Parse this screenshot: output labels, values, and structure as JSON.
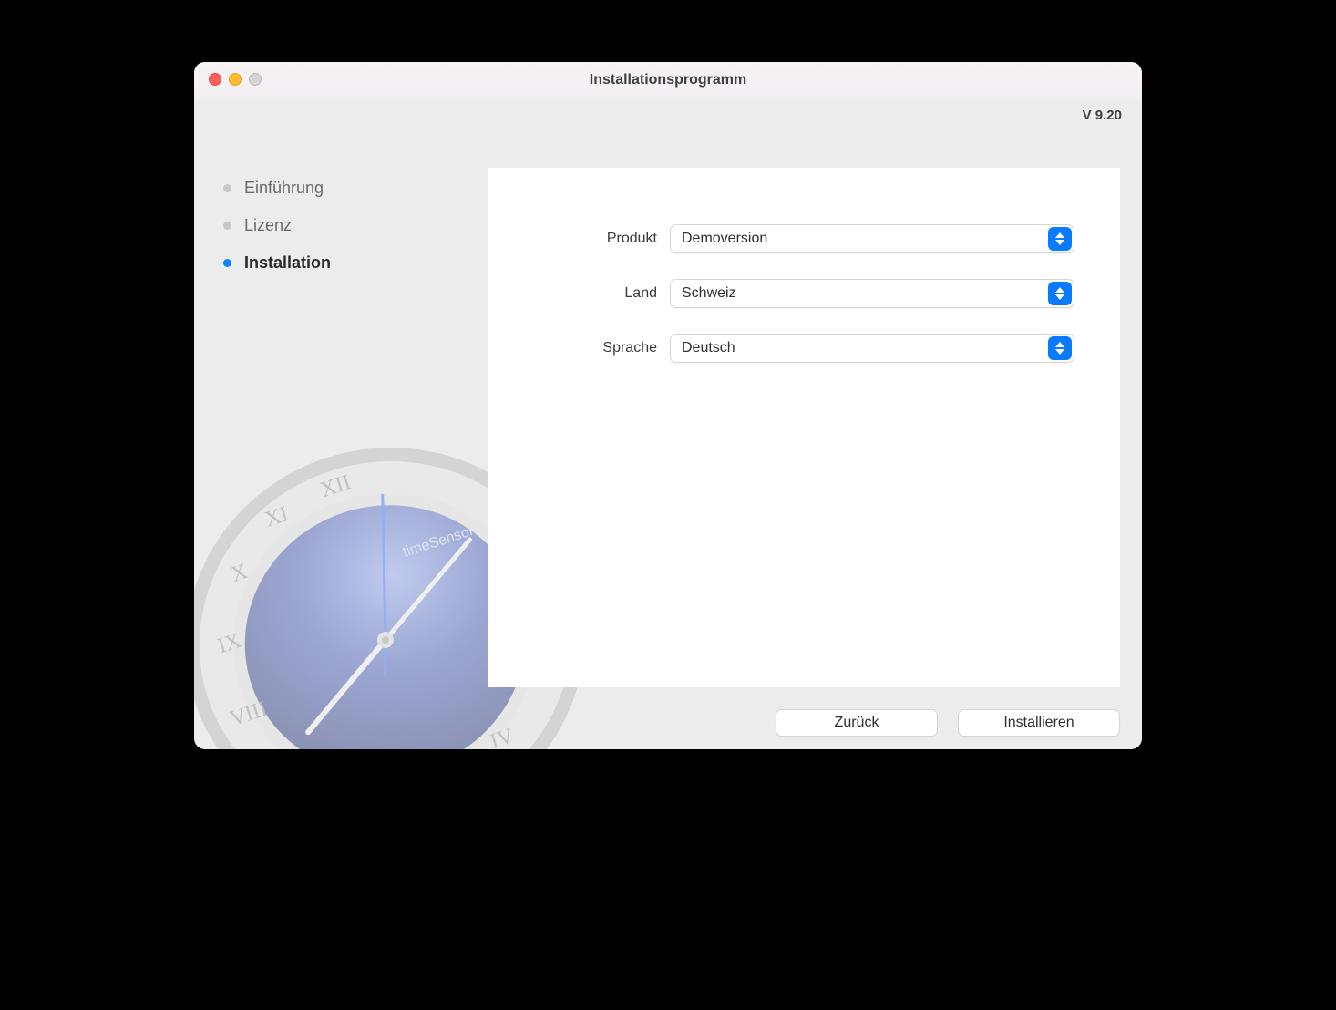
{
  "window": {
    "title": "Installationsprogramm",
    "version": "V 9.20"
  },
  "steps": [
    {
      "label": "Einführung",
      "active": false
    },
    {
      "label": "Lizenz",
      "active": false
    },
    {
      "label": "Installation",
      "active": true
    }
  ],
  "form": {
    "product": {
      "label": "Produkt",
      "value": "Demoversion"
    },
    "country": {
      "label": "Land",
      "value": "Schweiz"
    },
    "language": {
      "label": "Sprache",
      "value": "Deutsch"
    }
  },
  "watermark": {
    "brand": "timeSensor"
  },
  "buttons": {
    "back": "Zurück",
    "install": "Installieren"
  }
}
